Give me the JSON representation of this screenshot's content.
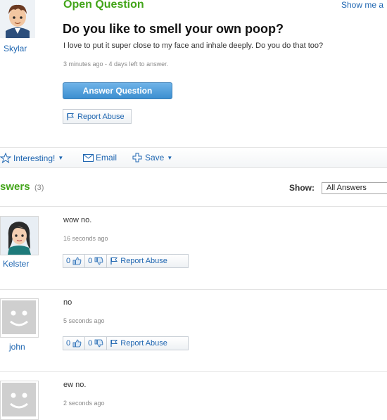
{
  "question": {
    "status_label": "Open Question",
    "show_me_link": "Show me a",
    "asker_name": "Skylar",
    "title": "Do you like to smell your own poop?",
    "body": "I love to put it super close to my face and inhale deeply. Do you do that too?",
    "meta": "3 minutes ago - 4 days left to answer.",
    "answer_button": "Answer Question",
    "report_abuse": "Report Abuse"
  },
  "actions": {
    "interesting": "Interesting!",
    "email": "Email",
    "save": "Save"
  },
  "answers_section": {
    "heading": "swers",
    "count": "(3)",
    "show_label": "Show:",
    "show_value": "All Answers"
  },
  "answers": [
    {
      "author": "Kelster",
      "text": "wow no.",
      "time": "16 seconds ago",
      "thumbs_up": "0",
      "thumbs_down": "0",
      "report": "Report Abuse"
    },
    {
      "author": "john",
      "text": "no",
      "time": "5 seconds ago",
      "thumbs_up": "0",
      "thumbs_down": "0",
      "report": "Report Abuse"
    },
    {
      "author": "",
      "text": "ew no.",
      "time": "2 seconds ago"
    }
  ],
  "colors": {
    "accent_green": "#43a51a",
    "link_blue": "#1f66b1",
    "button_blue": "#3c8fd0"
  },
  "icons": [
    "star-icon",
    "envelope-icon",
    "plus-icon",
    "flag-icon",
    "thumbs-up-icon",
    "thumbs-down-icon",
    "chevron-down-icon"
  ]
}
